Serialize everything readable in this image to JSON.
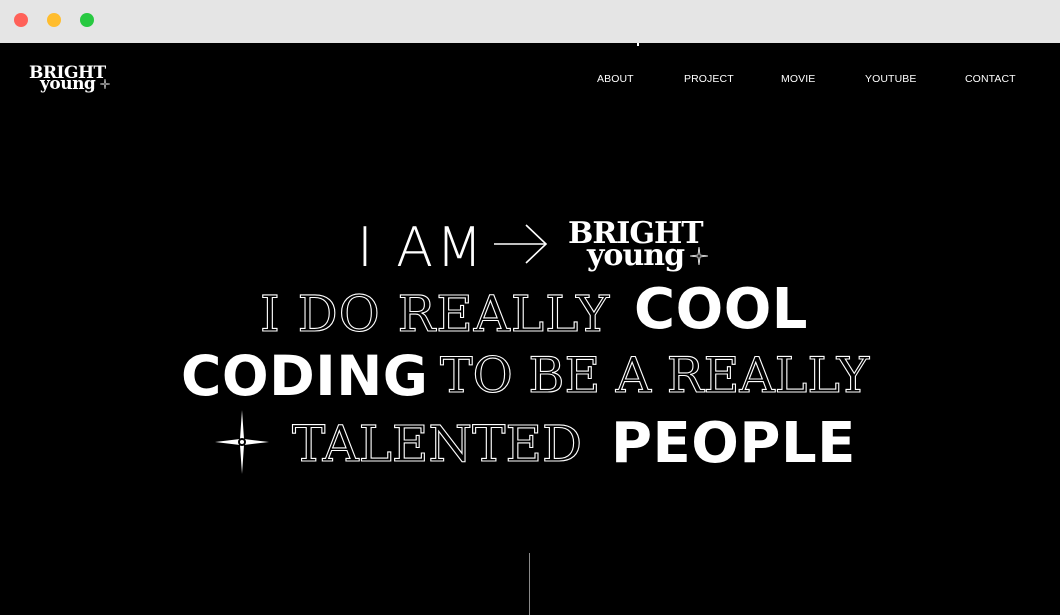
{
  "window": {
    "controls": [
      {
        "name": "close",
        "color": "#ff6159"
      },
      {
        "name": "minimize",
        "color": "#ffbd2e"
      },
      {
        "name": "maximize",
        "color": "#28c941"
      }
    ]
  },
  "brand": {
    "line1": "BRIGHT",
    "line2": "young",
    "icon": "sparkle-icon"
  },
  "nav": {
    "items": [
      {
        "label": "ABOUT"
      },
      {
        "label": "PROJECT"
      },
      {
        "label": "MOVIE"
      },
      {
        "label": "YOUTUBE"
      },
      {
        "label": "CONTACT"
      }
    ]
  },
  "hero": {
    "line1_text": "I AM",
    "arrow_icon": "arrow-right-icon",
    "line2_thin": "I DO REALLY",
    "line2_bold": "COOL",
    "line3_bold": "CODING",
    "line3_thin": "TO BE A REALLY",
    "star_icon": "four-point-star-icon",
    "line4_thin": "TALENTED",
    "line4_bold": "PEOPLE"
  },
  "colors": {
    "background": "#000000",
    "text": "#ffffff",
    "chrome": "#e5e5e5"
  }
}
